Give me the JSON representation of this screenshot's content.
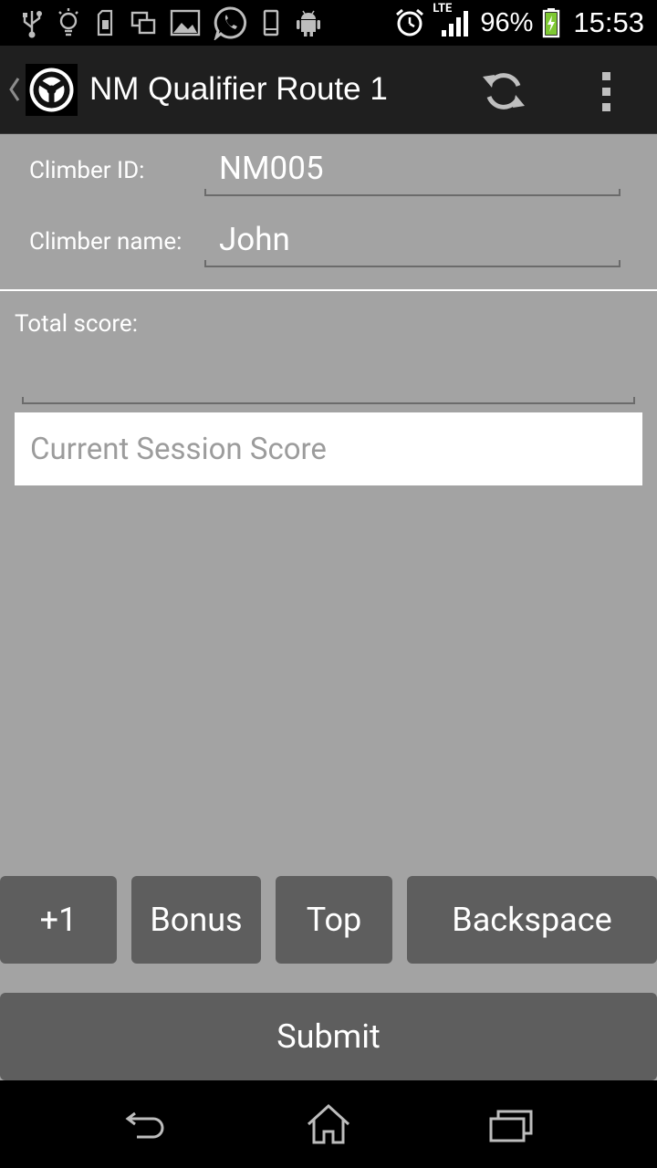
{
  "status_bar": {
    "network_type": "LTE",
    "battery_percent": "96%",
    "time": "15:53",
    "icons_left": [
      "usb-icon",
      "lightbulb-icon",
      "sd-transfer-icon",
      "screen-mirror-icon",
      "gallery-icon",
      "whatsapp-icon",
      "phone-icon",
      "android-icon"
    ],
    "icons_right": [
      "alarm-clock-icon",
      "signal-icon",
      "battery-charging-icon"
    ]
  },
  "action_bar": {
    "title": "NM Qualifier Route 1",
    "actions": [
      "refresh-icon",
      "overflow-menu-icon"
    ]
  },
  "form": {
    "climber_id_label": "Climber ID:",
    "climber_id_value": "NM005",
    "climber_name_label": "Climber name:",
    "climber_name_value": "John",
    "total_score_label": "Total score:",
    "total_score_value": "",
    "session_score_placeholder": "Current Session Score"
  },
  "keypad": {
    "plus_one": "+1",
    "bonus": "Bonus",
    "top": "Top",
    "backspace": "Backspace"
  },
  "submit_label": "Submit",
  "nav_bar": {
    "buttons": [
      "back-icon",
      "home-icon",
      "recent-apps-icon"
    ]
  },
  "colors": {
    "background": "#a3a3a3",
    "action_bar": "#1f1f1f",
    "button": "#5e5e5e",
    "status_bar": "#000000"
  }
}
